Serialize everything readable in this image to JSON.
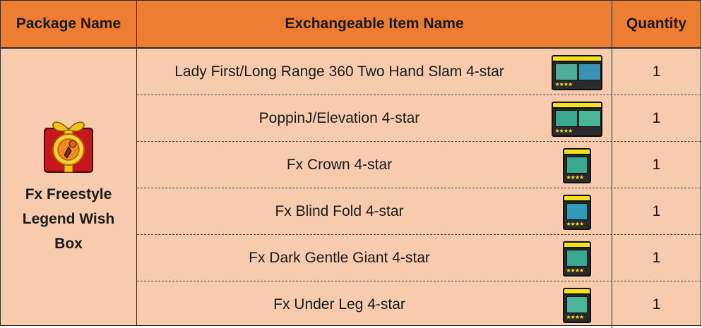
{
  "headers": {
    "package": "Package Name",
    "item": "Exchangeable Item Name",
    "quantity": "Quantity"
  },
  "package": {
    "name": "Fx Freestyle Legend Wish Box",
    "icon": "gift-box-icon"
  },
  "items": [
    {
      "name": "Lady First/Long Range 360 Two Hand Slam 4-star",
      "quantity": "1",
      "icon": "double-skill-card-icon"
    },
    {
      "name": "PoppinJ/Elevation 4-star",
      "quantity": "1",
      "icon": "double-skill-card-icon"
    },
    {
      "name": "Fx Crown 4-star",
      "quantity": "1",
      "icon": "skill-card-icon"
    },
    {
      "name": "Fx Blind Fold 4-star",
      "quantity": "1",
      "icon": "skill-card-icon"
    },
    {
      "name": "Fx Dark Gentle Giant 4-star",
      "quantity": "1",
      "icon": "skill-card-icon"
    },
    {
      "name": "Fx Under Leg 4-star",
      "quantity": "1",
      "icon": "skill-card-icon"
    }
  ],
  "colors": {
    "header_bg": "#ed7d31",
    "body_bg": "#f8cbad",
    "border": "#2b2b2b",
    "card_yellow": "#f5e21a",
    "card_teal": "#3aa88f"
  }
}
